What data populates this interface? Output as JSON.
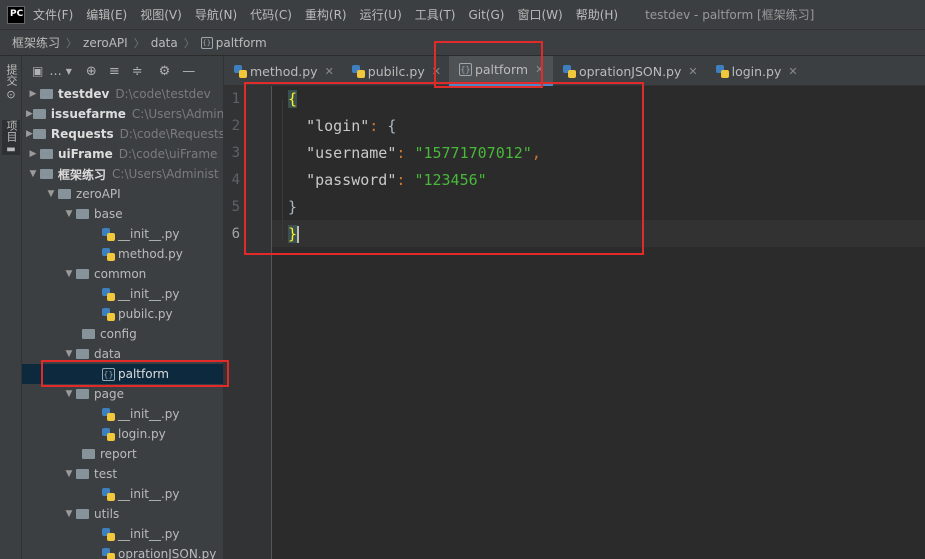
{
  "menubar": {
    "logo_top": "PC",
    "items": [
      "文件(F)",
      "编辑(E)",
      "视图(V)",
      "导航(N)",
      "代码(C)",
      "重构(R)",
      "运行(U)",
      "工具(T)",
      "Git(G)",
      "窗口(W)",
      "帮助(H)"
    ],
    "window_title": "testdev - paltform [框架练习]"
  },
  "breadcrumb": [
    "框架练习",
    "zeroAPI",
    "data",
    "paltform"
  ],
  "left_strip": {
    "commit": "提交",
    "project": "项目"
  },
  "project_toolbar": {
    "view_mode": "..."
  },
  "tree": [
    {
      "name": "testdev",
      "path": "D:\\code\\testdev",
      "root": true
    },
    {
      "name": "issuefarme",
      "path": "C:\\Users\\Administ",
      "root": true
    },
    {
      "name": "Requests",
      "path": "D:\\code\\Requests",
      "root": true
    },
    {
      "name": "uiFrame",
      "path": "D:\\code\\uiFrame",
      "root": true
    },
    {
      "name": "框架练习",
      "path": "C:\\Users\\Administ",
      "root": true
    },
    {
      "name": "zeroAPI"
    },
    {
      "name": "base"
    },
    {
      "name": "__init__.py"
    },
    {
      "name": "method.py"
    },
    {
      "name": "common"
    },
    {
      "name": "__init__.py"
    },
    {
      "name": "pubilc.py"
    },
    {
      "name": "config"
    },
    {
      "name": "data"
    },
    {
      "name": "paltform"
    },
    {
      "name": "page"
    },
    {
      "name": "__init__.py"
    },
    {
      "name": "login.py"
    },
    {
      "name": "report"
    },
    {
      "name": "test"
    },
    {
      "name": "__init__.py"
    },
    {
      "name": "utils"
    },
    {
      "name": "__init__.py"
    },
    {
      "name": "oprationJSON.py"
    }
  ],
  "tabs": [
    "method.py",
    "pubilc.py",
    "paltform",
    "oprationJSON.py",
    "login.py"
  ],
  "editor": {
    "line_numbers": [
      "1",
      "2",
      "3",
      "4",
      "5",
      "6"
    ],
    "open_brace": "{",
    "close_brace": "}",
    "login_key": "\"login\"",
    "username_key": "\"username\"",
    "username_value": "\"15771707012\"",
    "password_key": "\"password\"",
    "password_value": "\"123456\"",
    "colon": ":",
    "comma": ",",
    "inner_open": "{"
  },
  "colors": {
    "annotation_red": "#e32a2a",
    "selection": "#0d293e",
    "accent": "#4a88c7"
  }
}
